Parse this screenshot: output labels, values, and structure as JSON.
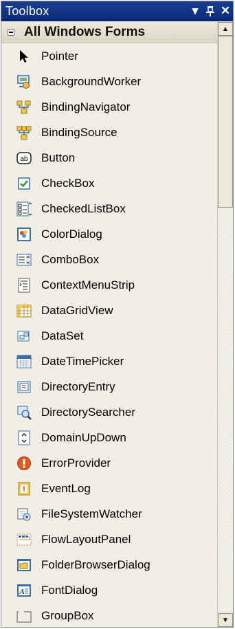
{
  "window": {
    "title": "Toolbox",
    "dropdown_icon": "▾",
    "pin_icon": "ᵼ",
    "close_icon": "✕"
  },
  "category": {
    "label": "All Windows Forms"
  },
  "items": [
    {
      "label": "Pointer",
      "icon": "pointer-icon"
    },
    {
      "label": "BackgroundWorker",
      "icon": "background-worker-icon"
    },
    {
      "label": "BindingNavigator",
      "icon": "binding-navigator-icon"
    },
    {
      "label": "BindingSource",
      "icon": "binding-source-icon"
    },
    {
      "label": "Button",
      "icon": "button-icon"
    },
    {
      "label": "CheckBox",
      "icon": "checkbox-icon"
    },
    {
      "label": "CheckedListBox",
      "icon": "checked-listbox-icon"
    },
    {
      "label": "ColorDialog",
      "icon": "color-dialog-icon"
    },
    {
      "label": "ComboBox",
      "icon": "combobox-icon"
    },
    {
      "label": "ContextMenuStrip",
      "icon": "context-menu-strip-icon"
    },
    {
      "label": "DataGridView",
      "icon": "data-grid-view-icon"
    },
    {
      "label": "DataSet",
      "icon": "dataset-icon"
    },
    {
      "label": "DateTimePicker",
      "icon": "date-time-picker-icon"
    },
    {
      "label": "DirectoryEntry",
      "icon": "directory-entry-icon"
    },
    {
      "label": "DirectorySearcher",
      "icon": "directory-searcher-icon"
    },
    {
      "label": "DomainUpDown",
      "icon": "domain-up-down-icon"
    },
    {
      "label": "ErrorProvider",
      "icon": "error-provider-icon"
    },
    {
      "label": "EventLog",
      "icon": "event-log-icon"
    },
    {
      "label": "FileSystemWatcher",
      "icon": "file-system-watcher-icon"
    },
    {
      "label": "FlowLayoutPanel",
      "icon": "flow-layout-panel-icon"
    },
    {
      "label": "FolderBrowserDialog",
      "icon": "folder-browser-dialog-icon"
    },
    {
      "label": "FontDialog",
      "icon": "font-dialog-icon"
    },
    {
      "label": "GroupBox",
      "icon": "group-box-icon"
    }
  ],
  "button_icon_text": "ab",
  "event_log_icon_text": "!",
  "font_dialog_icon_text": "A",
  "scrollbar": {
    "up_arrow": "▲",
    "down_arrow": "▼"
  },
  "colors": {
    "titlebar": "#0a2a78",
    "background": "#f1efe5",
    "category": "#d9d5c3"
  }
}
